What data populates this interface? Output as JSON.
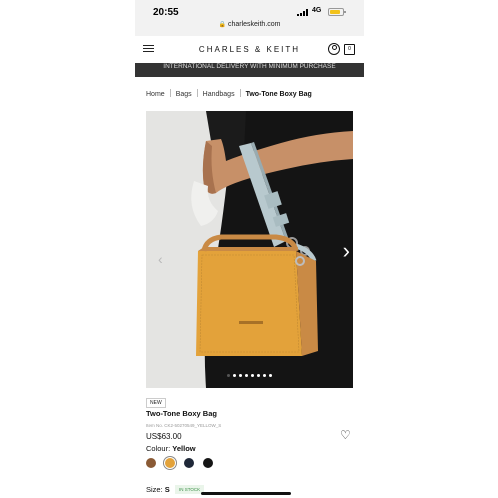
{
  "status_bar": {
    "time": "20:55",
    "url": "charleskeith.com",
    "network": "4G"
  },
  "header": {
    "logo": "CHARLES & KEITH",
    "cart_count": "0"
  },
  "banner": {
    "text": "INTERNATIONAL DELIVERY WITH MINIMUM PURCHASE"
  },
  "breadcrumb": [
    "Home",
    "Bags",
    "Handbags",
    "Two-Tone Boxy Bag"
  ],
  "gallery": {
    "image_count": 8,
    "active_index": 0,
    "prev_arrow": "‹",
    "next_arrow": "›"
  },
  "product": {
    "badge": "NEW",
    "name": "Two-Tone Boxy Bag",
    "item_no": "Item No. CK2-50270549_YELLOW_S",
    "price": "US$63.00",
    "colour_label": "Colour:",
    "colour_value": "Yellow",
    "swatches": [
      {
        "name": "brown",
        "color": "#8a5a35"
      },
      {
        "name": "yellow",
        "color": "#e3a23a"
      },
      {
        "name": "navy",
        "color": "#1f2838"
      },
      {
        "name": "black",
        "color": "#151515"
      }
    ],
    "selected_swatch": 1,
    "size_label": "Size:",
    "size_value": "S",
    "stock": "IN STOCK"
  },
  "colors": {
    "banner_bg": "#333333",
    "bag_yellow": "#e3a23a",
    "bag_tan": "#c98a45",
    "strap_blue": "#b8c9ce",
    "stock_green": "#3b8f48"
  }
}
